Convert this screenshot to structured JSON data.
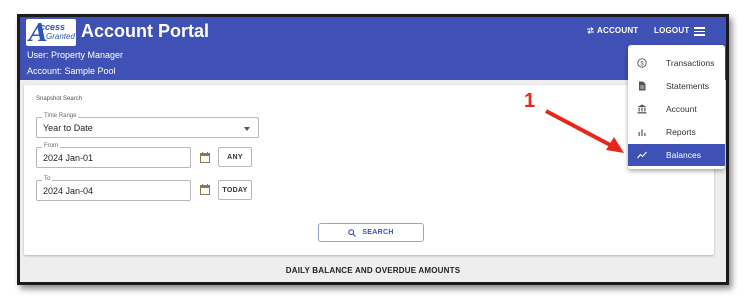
{
  "app": {
    "logo_big": "A",
    "logo_line1": "ccess",
    "logo_line2": "Granted",
    "title": "Account Portal",
    "user_line": "User: Property Manager",
    "account_line": "Account: Sample Pool"
  },
  "nav": {
    "account_icon": "swap-icon",
    "account_label": "ACCOUNT",
    "logout_label": "LOGOUT",
    "menu_icon": "hamburger-icon"
  },
  "form": {
    "section_label": "Snapshot Search",
    "time_range": {
      "label": "Time Range",
      "value": "Year to Date"
    },
    "from": {
      "label": "From",
      "value": "2024 Jan-01",
      "button": "ANY"
    },
    "to": {
      "label": "To",
      "value": "2024 Jan-04",
      "button": "TODAY"
    },
    "search_label": "SEARCH"
  },
  "section_title": "DAILY BALANCE AND OVERDUE AMOUNTS",
  "menu": {
    "items": [
      {
        "label": "Transactions",
        "icon": "dollar-circle-icon"
      },
      {
        "label": "Statements",
        "icon": "document-icon"
      },
      {
        "label": "Account",
        "icon": "bank-icon"
      },
      {
        "label": "Reports",
        "icon": "bar-chart-icon"
      },
      {
        "label": "Balances",
        "icon": "trend-line-icon",
        "active": true
      }
    ]
  },
  "annotation": {
    "number": "1",
    "color": "#e8261c"
  },
  "colors": {
    "primary": "#3f51b5",
    "background": "#eeeeee"
  }
}
